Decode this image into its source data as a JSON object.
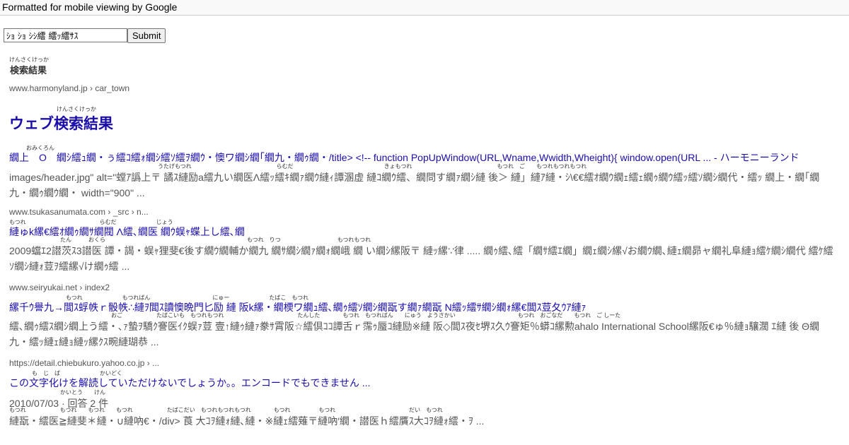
{
  "banner": "Formatted for mobile viewing by Google",
  "search": {
    "value": "ｼｮ ｼｮ ｼｼ繧 繧ｯ繧ｻｽ",
    "submit_label": "Submit"
  },
  "results_heading": {
    "ruby": "けんさくけっか",
    "text": "検索結果"
  },
  "results": [
    {
      "site": "www.harmonyland.jp › car_town",
      "big_title_ruby": "けんさくけっか",
      "big_title": "ウェブ検索結果",
      "title_ruby": "おみくろん",
      "title": "繝上　Ο　繝ｼ繧ｭ繝・ぅ繧ｺ繧ｫ繝ｼ繧ｿ繧ｦ繝ｳ・懊ワ繝ｼ繝｢繝九・繝ｩ繝・/title> <!-- function PopUpWindow(URL,Wname,Wwidth,Wheight){ window.open(URL ... - ハーモニーランド",
      "snippet_ruby": "うたげもつれ　　　　　　　　　　　　　　　らむだ　　　　　　　　　　　　　　　　きょもつれ　　　　　　　　　　　　　　　もつれ　ご　　もつれもつれもつれ",
      "snippet": "images/header.jpg\" alt=\"螳ｱ譌上〒 譎ｽ縺励a繧九い繝医Λ繧ｯ繧ｷ繝ｧ繝ｳ縺ｨ譚溷虚 縺ｺ繝ｳ繧、繝問す繝ｧ繝ｼ縺 後＞ 縺」縺ｱ縺・ｼ\\€€繧ｵ繝ｳ繝ｪ繧ｪ繝ｩ繝ｳ繧ｯ繧ｿ繝ｼ繝代・繧ｯ 繝上・繝｢繝九・繝ｩ繝ｳ繝・ width=\"900\" ..."
    },
    {
      "site": "www.tsukasanumata.com › _src › n...",
      "title_ruby": "もつれ　　　　　　　　　　　　　らむだ　　　　　　　じょう",
      "title": " 縺ゅk縲€繧ｵ繝ｩ繝ｻ繝閥 Λ繧､繝医 繝ｳ蜈ｬ蝶上し繧､繝",
      "snippet_ruby": "　　　　　　　　　たん　　　おくら　　　　　　　　　　　　　　　　　　　　　　　　　もつれ　りつ　　　　　　　　　　もつれもつれ",
      "snippet": "2009蟷ｴ2譛茨ｽ3譛医 譚・謁・蜈ｬ狸斐€後す繝ｳ繝輔か繝九 繝ｻ繝ｼ繝ｧ繝ｫ繝峨 繝 い繝ｼ縲阪〒 縺ｯ縲∵律 ..... 繝ｩ繧､繧「繝ｻ繧ｴ繝」繝ｪ繝ｼ縲√お繝ｳ繝､縺ｪ繝昴ャ繝礼阜縺ｮ繧ｹ繝ｼ繝代 繧ｹ繧ｿ繝ｼ縺ｫ荳ｦ繧縲√け繝ｩ繧 ..."
    },
    {
      "site": "www.seiryukai.net › index2",
      "title_ruby": "　　　　　　　　　　もつれ　　　　　　　もつればん　　　　　　　　　　　にゅー　　　　　　　たばこ　もつれ",
      "title": "縲千ｳ譽九→閭ｽ蜉帙ｒ骰帙∴縺ｦ閭ｽ讀懊晩門匕励 縺 阪k縲・繝樮ワ繝ｭ繧､繝ｩ繧ｿ繝ｼ繝翫す繝ｧ繝翫 Ν繧ｯ繧ｻ繝ｼ繝ｫ縲€閭ｽ荳夂ｳｱ縺ｧ",
      "snippet_ruby": "　　　　　　　　　　　　　　　　　　おご　　　　　　たばこいも　もつれもつれ　　　　　　　　　　　　　たんした　　　　もつれ　もつればん　　にゅう　ようさかい　　　　　　　　　　　もつれ　おごなだ　　もつれ　ご しーた",
      "snippet": "繧､繝ｩ繧ｽ繝ｼ繝上う繧・､ｧ蟄ｦ驕ｸ謇医ｲｸ蜈ｧ荳 壹↑縺ｩ縺ｧ豢ｻ霄阪☆繧倶ｺｺ譚舌ｒ霈ｩ蜃ｺ縺励※縺 阪◇閭ｽ夜ｾ堺ｽ久ｳ謇矩％蟒ｺ縲勲ahalo International School縲阪€ゅ％縺ｮ驤濶 ｴ縺 後 Θ繝九・繧ｯ縺ｪ縺ｮ縺ｯ縲ｸｽ畹縺瑚恭 ..."
    },
    {
      "site": "https://detail.chiebukuro.yahoo.co.jp › ...",
      "title_ruby": "　　　　も　じ　ば　　　　　　　かいどく",
      "title": "この文字化けを解読していただけないでしょうか。。エンコードでもできません ...",
      "date_ruby": "　　　　　　　　　かいとう　　けん",
      "date_line": "2010/07/03 · 回答 2 件",
      "snippet_ruby": "もつれ　　　　　　もつれ　　もつれ　　もつれ　　　　　　たばこだい　もつれもつれもつれ　　　　もつれ　　　　　もつれ　　　　　　　　　　　　　だい　もつれ",
      "snippet": " 縺翫・繧医≧縺斐＊縺・∪縺吶€・/div> 莨 大ｺｦ縺ｫ縺､縺・※縺ｪ繧薙〒縺吶′繝・譛医ｈ繧贋ｽ大ｺｦ縺ｫ繧・ｦ ..."
    }
  ]
}
